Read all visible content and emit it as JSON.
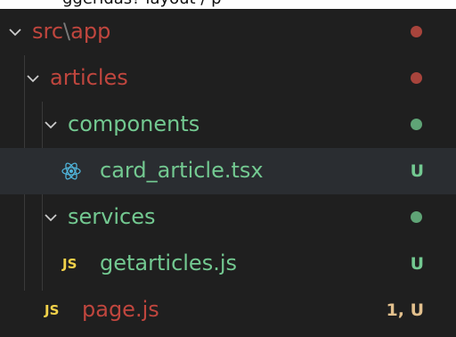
{
  "header_peek": "ggeridas?  layout / p",
  "colors": {
    "conflict": "#c0463e",
    "added": "#73c991",
    "modified": "#e2c08d",
    "background": "#1f1f1f",
    "selected_row": "#2a2d31"
  },
  "tree": {
    "src_app": {
      "label_a": "src",
      "sep": "\\",
      "label_b": "app",
      "icon": "chevron-down-icon"
    },
    "articles": {
      "label": "articles",
      "icon": "chevron-down-icon"
    },
    "components": {
      "label": "components",
      "icon": "chevron-down-icon"
    },
    "card_article": {
      "label": "card_article.tsx",
      "status": "U",
      "icon": "react-icon"
    },
    "services": {
      "label": "services",
      "icon": "chevron-down-icon"
    },
    "getarticles": {
      "label": "getarticles.js",
      "icon_text": "JS",
      "status": "U"
    },
    "page": {
      "label": "page.js",
      "icon_text": "JS",
      "status": "1, U"
    }
  }
}
